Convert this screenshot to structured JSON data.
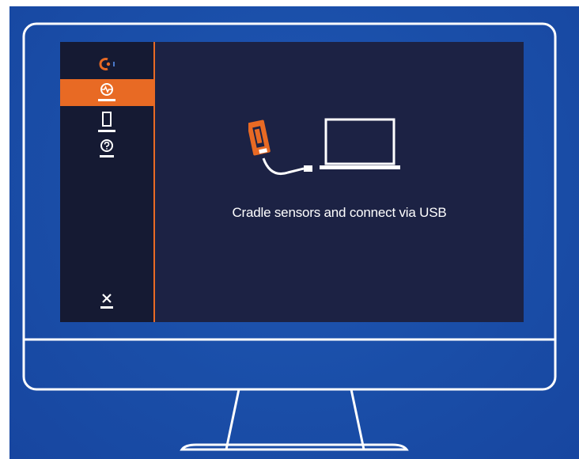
{
  "main": {
    "instruction_text": "Cradle sensors and connect via USB"
  },
  "sidebar": {
    "items": [
      {
        "icon": "logo-icon",
        "active": false
      },
      {
        "icon": "activity-icon",
        "active": true
      },
      {
        "icon": "device-icon",
        "active": false
      },
      {
        "icon": "help-icon",
        "active": false
      },
      {
        "icon": "close-icon",
        "active": false
      }
    ]
  },
  "colors": {
    "background": "#1a4ea8",
    "screen": "#1c2244",
    "sidebar": "#151a33",
    "accent": "#e86a24",
    "monitor_outline": "#ffffff"
  }
}
